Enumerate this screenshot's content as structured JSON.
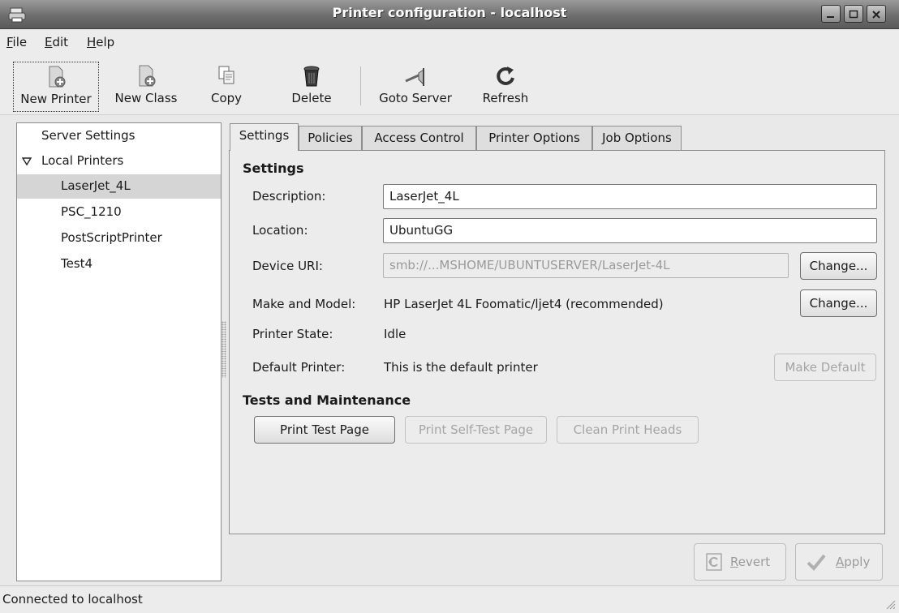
{
  "window": {
    "title": "Printer configuration - localhost"
  },
  "menu": [
    {
      "label": "File",
      "mnemonic": "F",
      "rest": "ile"
    },
    {
      "label": "Edit",
      "mnemonic": "E",
      "rest": "dit"
    },
    {
      "label": "Help",
      "mnemonic": "H",
      "rest": "elp"
    }
  ],
  "toolbar": {
    "new_printer": "New Printer",
    "new_class": "New Class",
    "copy": "Copy",
    "delete": "Delete",
    "goto_server": "Goto Server",
    "refresh": "Refresh"
  },
  "tree": {
    "server_settings": "Server Settings",
    "local_printers": "Local Printers",
    "printers": [
      "LaserJet_4L",
      "PSC_1210",
      "PostScriptPrinter",
      "Test4"
    ],
    "selected": "LaserJet_4L"
  },
  "tabs": [
    "Settings",
    "Policies",
    "Access Control",
    "Printer Options",
    "Job Options"
  ],
  "settings": {
    "heading": "Settings",
    "description_label": "Description:",
    "description_value": "LaserJet_4L",
    "location_label": "Location:",
    "location_value": "UbuntuGG",
    "device_uri_label": "Device URI:",
    "device_uri_value": "smb://...MSHOME/UBUNTUSERVER/LaserJet-4L",
    "change_label": "Change...",
    "make_model_label": "Make and Model:",
    "make_model_value": "HP LaserJet 4L Foomatic/ljet4 (recommended)",
    "printer_state_label": "Printer State:",
    "printer_state_value": "Idle",
    "default_printer_label": "Default Printer:",
    "default_printer_value": "This is the default printer",
    "make_default": "Make Default"
  },
  "maintenance": {
    "heading": "Tests and Maintenance",
    "print_test_page": "Print Test Page",
    "print_self_test_page": "Print Self-Test Page",
    "clean_print_heads": "Clean Print Heads"
  },
  "actions": {
    "revert": "Revert",
    "revert_mnemonic": "R",
    "revert_rest": "evert",
    "apply": "Apply",
    "apply_mnemonic": "A",
    "apply_rest": "pply"
  },
  "status": {
    "text": "Connected to localhost"
  }
}
